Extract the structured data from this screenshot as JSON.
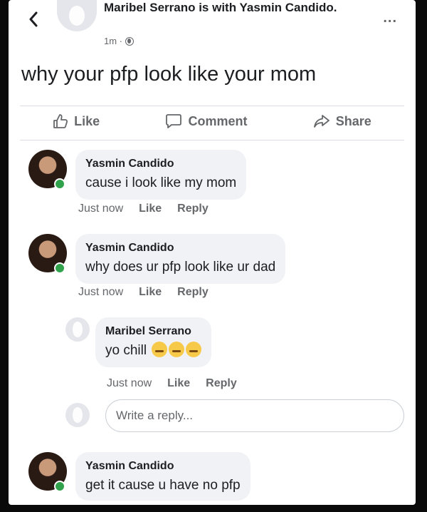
{
  "header": {
    "author_line": "Maribel Serrano is with Yasmin Candido.",
    "time": "1m ·",
    "more_label": "..."
  },
  "post": {
    "text": "why your pfp look like your mom"
  },
  "actions": {
    "like": "Like",
    "comment": "Comment",
    "share": "Share"
  },
  "comments": [
    {
      "name": "Yasmin Candido",
      "text": "cause i look like my mom",
      "time": "Just now",
      "like": "Like",
      "reply": "Reply"
    },
    {
      "name": "Yasmin Candido",
      "text": "why does ur pfp look like ur dad",
      "time": "Just now",
      "like": "Like",
      "reply": "Reply"
    },
    {
      "name": "Yasmin Candido",
      "text": "get it cause u have no pfp"
    }
  ],
  "nested_reply": {
    "name": "Maribel Serrano",
    "text": "yo chill",
    "emoji_count": 3,
    "time": "Just now",
    "like": "Like",
    "reply": "Reply"
  },
  "reply_input": {
    "placeholder": "Write a reply..."
  },
  "icons": {
    "back": "chevron-left-icon",
    "globe": "globe-icon",
    "like": "thumbs-up-icon",
    "comment": "speech-bubble-icon",
    "share": "share-arrow-icon",
    "emoji": "downcast-face-emoji"
  },
  "colors": {
    "online": "#31a24c",
    "muted_text": "#65676b",
    "bubble_bg": "#f0f2f5"
  }
}
